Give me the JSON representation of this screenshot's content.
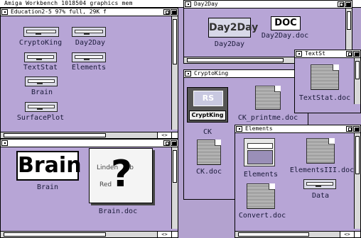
{
  "screen_title": "Amiga Workbench  1018504 graphics mem",
  "windows": {
    "education": {
      "title": "Education2-5  97% full, 29K f"
    },
    "brainwin": {
      "title": ""
    },
    "day2day": {
      "title": "Day2Day"
    },
    "cryptoking": {
      "title": "CryptoKing"
    },
    "textstat": {
      "title": "TextSt"
    },
    "elements": {
      "title": "Elements"
    }
  },
  "icons": {
    "cryptoking": "CryptoKing",
    "day2day_drawer": "Day2Day",
    "textstat": "TextStat",
    "elements_drawer": "Elements",
    "brain_drawer": "Brain",
    "surfaceplot": "SurfacePlot",
    "brain_tool": "Brain",
    "brain_tool_art": "Brain",
    "brain_doc": "Brain.doc",
    "brain_doc_art": "?",
    "day2day_tool": "Day2Day",
    "day2day_tool_art": "Day2Day",
    "day2day_doc": "Day2Day.doc",
    "day2day_doc_art": "DOC",
    "crypto_ck": "CK",
    "crypto_ck_art": "CryptKing",
    "ck_printme": "CK_printme.doc",
    "ck_doc": "CK.doc",
    "textstat_doc": "TextStat.doc",
    "elements_tool": "Elements",
    "elementsiii_doc": "ElementsIII.doc",
    "data_drawer": "Data",
    "convert_doc": "Convert.doc"
  }
}
